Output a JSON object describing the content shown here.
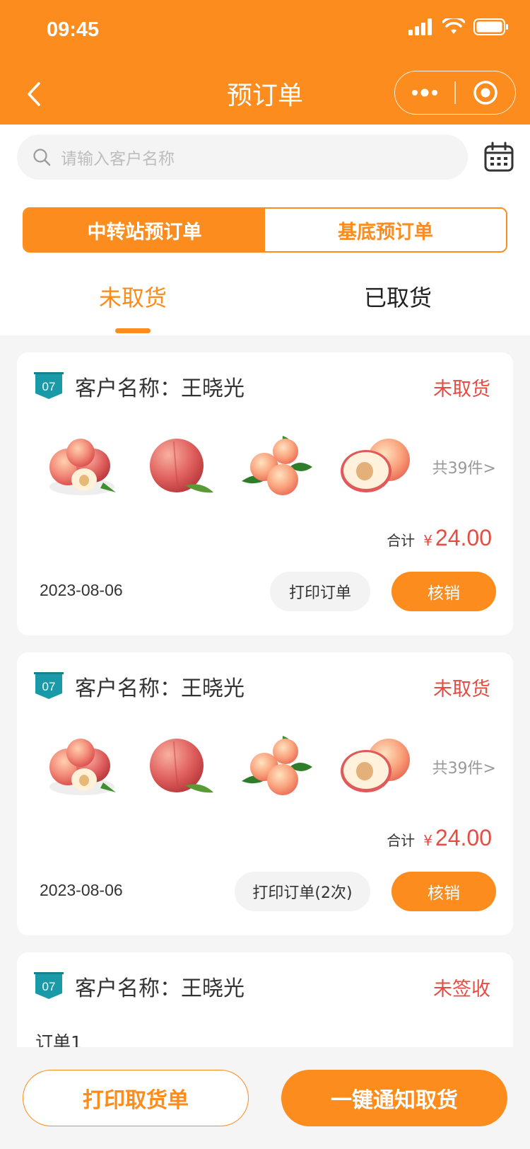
{
  "status_bar": {
    "time": "09:45"
  },
  "nav": {
    "title": "预订单"
  },
  "search": {
    "placeholder": "请输入客户名称"
  },
  "segment": {
    "active": "中转站预订单",
    "inactive": "基底预订单"
  },
  "tabs": {
    "active": "未取货",
    "inactive": "已取货"
  },
  "colors": {
    "primary": "#fb8c1d",
    "danger": "#e54d42",
    "badge": "#1a9aa8"
  },
  "orders": [
    {
      "badge": "07",
      "customer": "客户名称：王晓光",
      "status": "未取货",
      "count": "共39件>",
      "total_label": "合计",
      "currency": "¥",
      "amount": "24.00",
      "date": "2023-08-06",
      "print_label": "打印订单",
      "verify_label": "核销"
    },
    {
      "badge": "07",
      "customer": "客户名称：王晓光",
      "status": "未取货",
      "count": "共39件>",
      "total_label": "合计",
      "currency": "¥",
      "amount": "24.00",
      "date": "2023-08-06",
      "print_label": "打印订单(2次)",
      "verify_label": "核销"
    },
    {
      "badge": "07",
      "customer": "客户名称：王晓光",
      "status": "未签收",
      "order_label": "订单1"
    }
  ],
  "bottom": {
    "print_pickup": "打印取货单",
    "notify_pickup": "一键通知取货"
  }
}
